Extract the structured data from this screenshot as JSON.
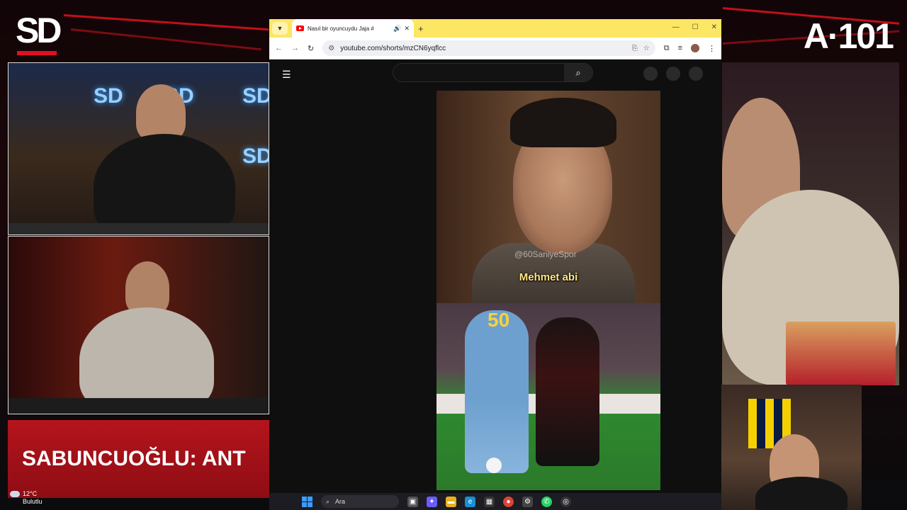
{
  "overlay": {
    "brand_left": "SD",
    "brand_right": "A·101",
    "ticker": "SABUNCUOĞLU: ANT",
    "weather_temp": "12°C",
    "weather_desc": "Bulutlu"
  },
  "browser": {
    "tab_title": "Nasıl bir oyuncuydu Jaja #",
    "url": "youtube.com/shorts/mzCN6yqflcc"
  },
  "video": {
    "watermark": "@60SaniyeSpor",
    "caption": "Mehmet abi",
    "jersey_number": "50"
  },
  "taskbar": {
    "search_label": "Ara"
  },
  "icons": {
    "hamburger": "menu-icon",
    "search": "search-icon",
    "windows": "windows-start-icon"
  },
  "colors": {
    "accent_red": "#c0101a",
    "chrome_tabbar": "#fde663",
    "youtube_bg": "#0f0f0f"
  }
}
